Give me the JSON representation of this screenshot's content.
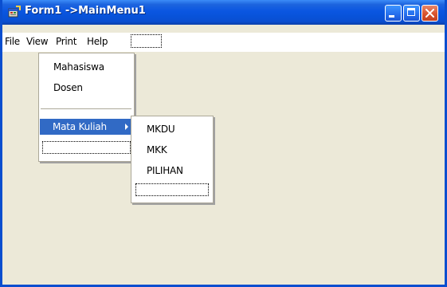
{
  "window": {
    "title": "Form1 ->MainMenu1",
    "app_icon": "vb-form-icon",
    "controls": {
      "minimize": "minimize-icon",
      "maximize": "maximize-icon",
      "close": "close-icon"
    }
  },
  "menubar": {
    "items": [
      {
        "label": "File"
      },
      {
        "label": "View"
      },
      {
        "label": "Print"
      },
      {
        "label": "Help"
      }
    ],
    "new_item_placeholder": ""
  },
  "view_menu": {
    "items": [
      {
        "label": "Mahasiswa"
      },
      {
        "label": "Dosen"
      },
      {
        "label": "Mata Kuliah",
        "has_submenu": true,
        "highlighted": true
      }
    ],
    "new_item_placeholder": ""
  },
  "submenu_mata_kuliah": {
    "items": [
      {
        "label": "MKDU"
      },
      {
        "label": "MKK"
      },
      {
        "label": "PILIHAN"
      }
    ],
    "new_item_placeholder": ""
  },
  "colors": {
    "titlebar": "#0A4ECF",
    "client_area": "#ECE9D8",
    "menu_highlight": "#316AC5",
    "close_button": "#D8542E"
  }
}
